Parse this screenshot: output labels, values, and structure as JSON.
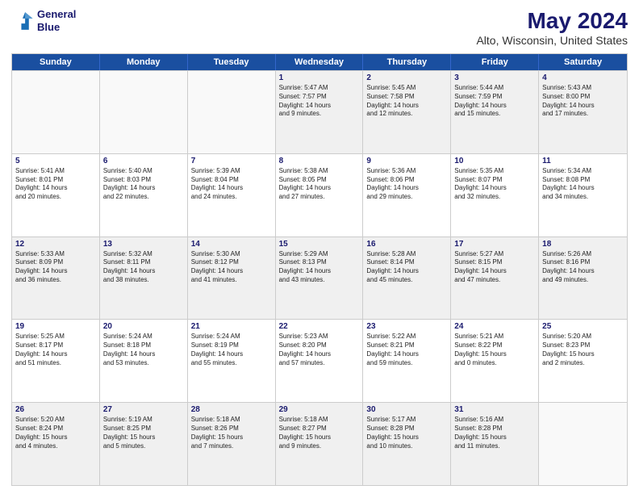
{
  "logo": {
    "line1": "General",
    "line2": "Blue"
  },
  "title": "May 2024",
  "subtitle": "Alto, Wisconsin, United States",
  "header_days": [
    "Sunday",
    "Monday",
    "Tuesday",
    "Wednesday",
    "Thursday",
    "Friday",
    "Saturday"
  ],
  "rows": [
    [
      {
        "day": "",
        "text": ""
      },
      {
        "day": "",
        "text": ""
      },
      {
        "day": "",
        "text": ""
      },
      {
        "day": "1",
        "text": "Sunrise: 5:47 AM\nSunset: 7:57 PM\nDaylight: 14 hours\nand 9 minutes."
      },
      {
        "day": "2",
        "text": "Sunrise: 5:45 AM\nSunset: 7:58 PM\nDaylight: 14 hours\nand 12 minutes."
      },
      {
        "day": "3",
        "text": "Sunrise: 5:44 AM\nSunset: 7:59 PM\nDaylight: 14 hours\nand 15 minutes."
      },
      {
        "day": "4",
        "text": "Sunrise: 5:43 AM\nSunset: 8:00 PM\nDaylight: 14 hours\nand 17 minutes."
      }
    ],
    [
      {
        "day": "5",
        "text": "Sunrise: 5:41 AM\nSunset: 8:01 PM\nDaylight: 14 hours\nand 20 minutes."
      },
      {
        "day": "6",
        "text": "Sunrise: 5:40 AM\nSunset: 8:03 PM\nDaylight: 14 hours\nand 22 minutes."
      },
      {
        "day": "7",
        "text": "Sunrise: 5:39 AM\nSunset: 8:04 PM\nDaylight: 14 hours\nand 24 minutes."
      },
      {
        "day": "8",
        "text": "Sunrise: 5:38 AM\nSunset: 8:05 PM\nDaylight: 14 hours\nand 27 minutes."
      },
      {
        "day": "9",
        "text": "Sunrise: 5:36 AM\nSunset: 8:06 PM\nDaylight: 14 hours\nand 29 minutes."
      },
      {
        "day": "10",
        "text": "Sunrise: 5:35 AM\nSunset: 8:07 PM\nDaylight: 14 hours\nand 32 minutes."
      },
      {
        "day": "11",
        "text": "Sunrise: 5:34 AM\nSunset: 8:08 PM\nDaylight: 14 hours\nand 34 minutes."
      }
    ],
    [
      {
        "day": "12",
        "text": "Sunrise: 5:33 AM\nSunset: 8:09 PM\nDaylight: 14 hours\nand 36 minutes."
      },
      {
        "day": "13",
        "text": "Sunrise: 5:32 AM\nSunset: 8:11 PM\nDaylight: 14 hours\nand 38 minutes."
      },
      {
        "day": "14",
        "text": "Sunrise: 5:30 AM\nSunset: 8:12 PM\nDaylight: 14 hours\nand 41 minutes."
      },
      {
        "day": "15",
        "text": "Sunrise: 5:29 AM\nSunset: 8:13 PM\nDaylight: 14 hours\nand 43 minutes."
      },
      {
        "day": "16",
        "text": "Sunrise: 5:28 AM\nSunset: 8:14 PM\nDaylight: 14 hours\nand 45 minutes."
      },
      {
        "day": "17",
        "text": "Sunrise: 5:27 AM\nSunset: 8:15 PM\nDaylight: 14 hours\nand 47 minutes."
      },
      {
        "day": "18",
        "text": "Sunrise: 5:26 AM\nSunset: 8:16 PM\nDaylight: 14 hours\nand 49 minutes."
      }
    ],
    [
      {
        "day": "19",
        "text": "Sunrise: 5:25 AM\nSunset: 8:17 PM\nDaylight: 14 hours\nand 51 minutes."
      },
      {
        "day": "20",
        "text": "Sunrise: 5:24 AM\nSunset: 8:18 PM\nDaylight: 14 hours\nand 53 minutes."
      },
      {
        "day": "21",
        "text": "Sunrise: 5:24 AM\nSunset: 8:19 PM\nDaylight: 14 hours\nand 55 minutes."
      },
      {
        "day": "22",
        "text": "Sunrise: 5:23 AM\nSunset: 8:20 PM\nDaylight: 14 hours\nand 57 minutes."
      },
      {
        "day": "23",
        "text": "Sunrise: 5:22 AM\nSunset: 8:21 PM\nDaylight: 14 hours\nand 59 minutes."
      },
      {
        "day": "24",
        "text": "Sunrise: 5:21 AM\nSunset: 8:22 PM\nDaylight: 15 hours\nand 0 minutes."
      },
      {
        "day": "25",
        "text": "Sunrise: 5:20 AM\nSunset: 8:23 PM\nDaylight: 15 hours\nand 2 minutes."
      }
    ],
    [
      {
        "day": "26",
        "text": "Sunrise: 5:20 AM\nSunset: 8:24 PM\nDaylight: 15 hours\nand 4 minutes."
      },
      {
        "day": "27",
        "text": "Sunrise: 5:19 AM\nSunset: 8:25 PM\nDaylight: 15 hours\nand 5 minutes."
      },
      {
        "day": "28",
        "text": "Sunrise: 5:18 AM\nSunset: 8:26 PM\nDaylight: 15 hours\nand 7 minutes."
      },
      {
        "day": "29",
        "text": "Sunrise: 5:18 AM\nSunset: 8:27 PM\nDaylight: 15 hours\nand 9 minutes."
      },
      {
        "day": "30",
        "text": "Sunrise: 5:17 AM\nSunset: 8:28 PM\nDaylight: 15 hours\nand 10 minutes."
      },
      {
        "day": "31",
        "text": "Sunrise: 5:16 AM\nSunset: 8:28 PM\nDaylight: 15 hours\nand 11 minutes."
      },
      {
        "day": "",
        "text": ""
      }
    ]
  ]
}
